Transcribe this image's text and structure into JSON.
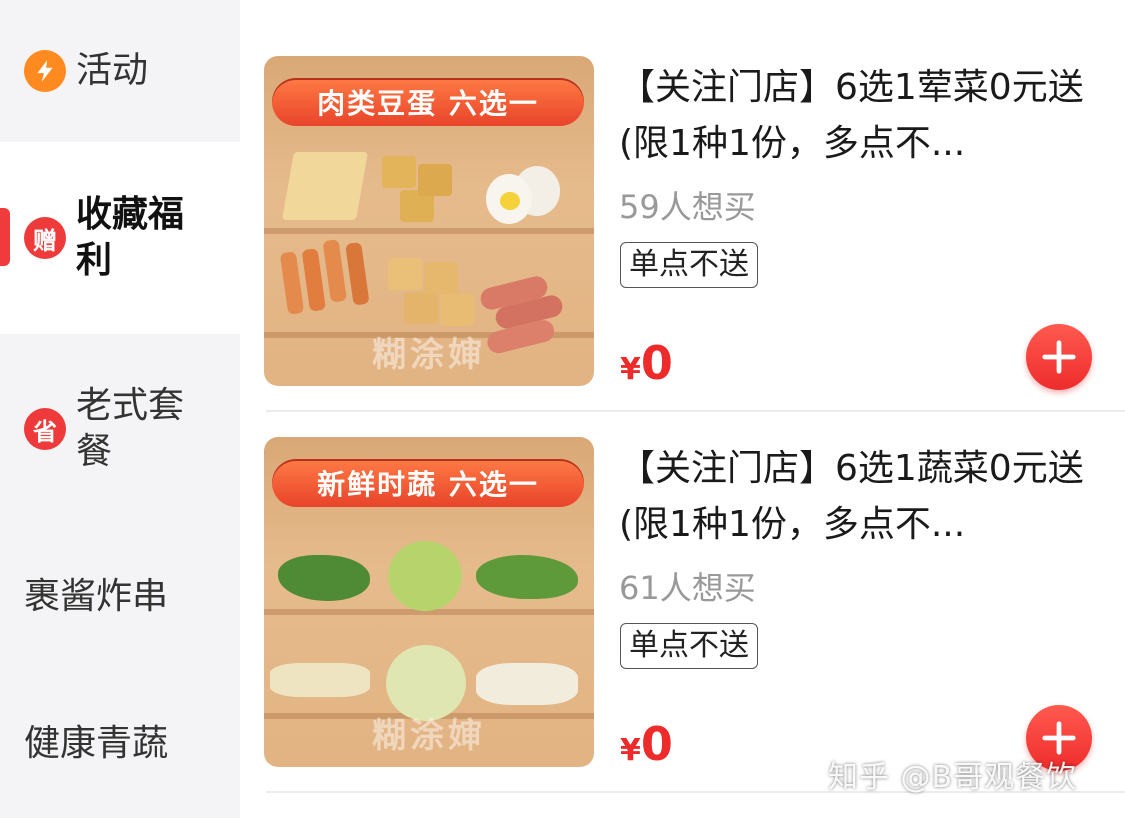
{
  "sidebar": {
    "items": [
      {
        "label": "活动",
        "icon": "lightning-icon"
      },
      {
        "label": "收藏福利",
        "badge": "赠"
      },
      {
        "label": "老式套餐",
        "badge": "省"
      },
      {
        "label": "裹酱炸串"
      },
      {
        "label": "健康青蔬"
      }
    ]
  },
  "products": [
    {
      "title": "【关注门店】6选1荤菜0元送(限1种1份，多点不...",
      "want": "59人想买",
      "tag": "单点不送",
      "currency": "¥",
      "price": "0",
      "image_banner": "肉类豆蛋 六选一",
      "image_watermark": "糊涂婶"
    },
    {
      "title": "【关注门店】6选1蔬菜0元送(限1种1份，多点不...",
      "want": "61人想买",
      "tag": "单点不送",
      "currency": "¥",
      "price": "0",
      "image_banner": "新鲜时蔬 六选一",
      "image_watermark": "糊涂婶"
    }
  ],
  "watermark": "知乎 @B哥观餐饮",
  "colors": {
    "accent": "#ee2b2b",
    "sidebar_bg": "#f4f4f6",
    "badge_orange": "#ff8a1f"
  }
}
